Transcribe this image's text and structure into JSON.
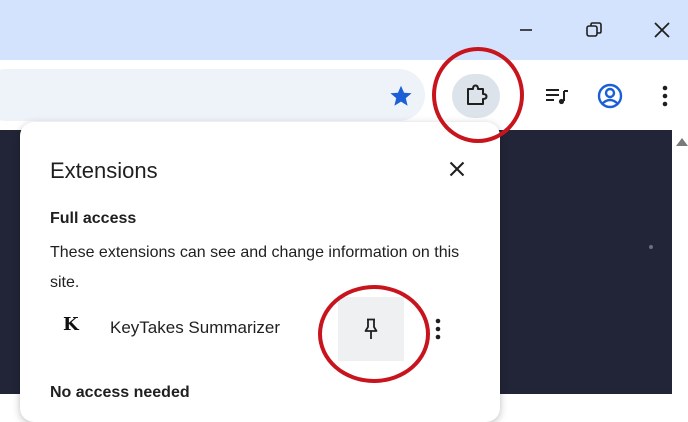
{
  "window_controls": {
    "minimize_icon": "minimize-icon",
    "restore_icon": "restore-icon",
    "close_icon": "close-icon"
  },
  "toolbar": {
    "bookmark_icon": "star-icon",
    "extensions_icon": "puzzle-icon",
    "media_icon": "media-queue-icon",
    "profile_icon": "profile-icon",
    "menu_icon": "kebab-menu-icon",
    "star_color": "#1a5fd6"
  },
  "extensions_panel": {
    "title": "Extensions",
    "full_access": {
      "heading": "Full access",
      "description": "These extensions can see and change information on this site.",
      "items": [
        {
          "logo": "K",
          "name": "KeyTakes Summarizer"
        }
      ]
    },
    "no_access_heading": "No access needed"
  },
  "annotation_color": "#c8141d"
}
